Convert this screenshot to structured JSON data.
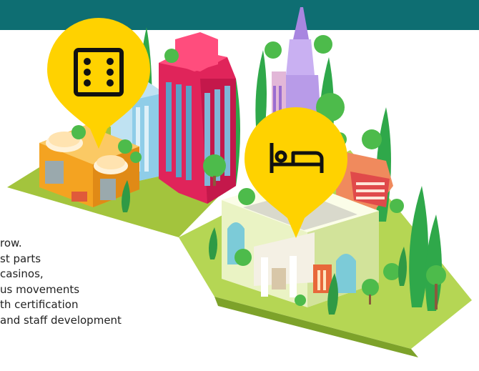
{
  "header": {
    "band_color": "#0e6e72"
  },
  "body_text": {
    "lines": [
      "row.",
      "st parts",
      "casinos,",
      "us movements",
      "th certification",
      "   and staff development"
    ]
  },
  "illustration": {
    "pins": [
      {
        "icon": "dice-icon",
        "color": "#ffd200"
      },
      {
        "icon": "bed-icon",
        "color": "#ffd200"
      }
    ],
    "ground_color": "#aed04a"
  }
}
